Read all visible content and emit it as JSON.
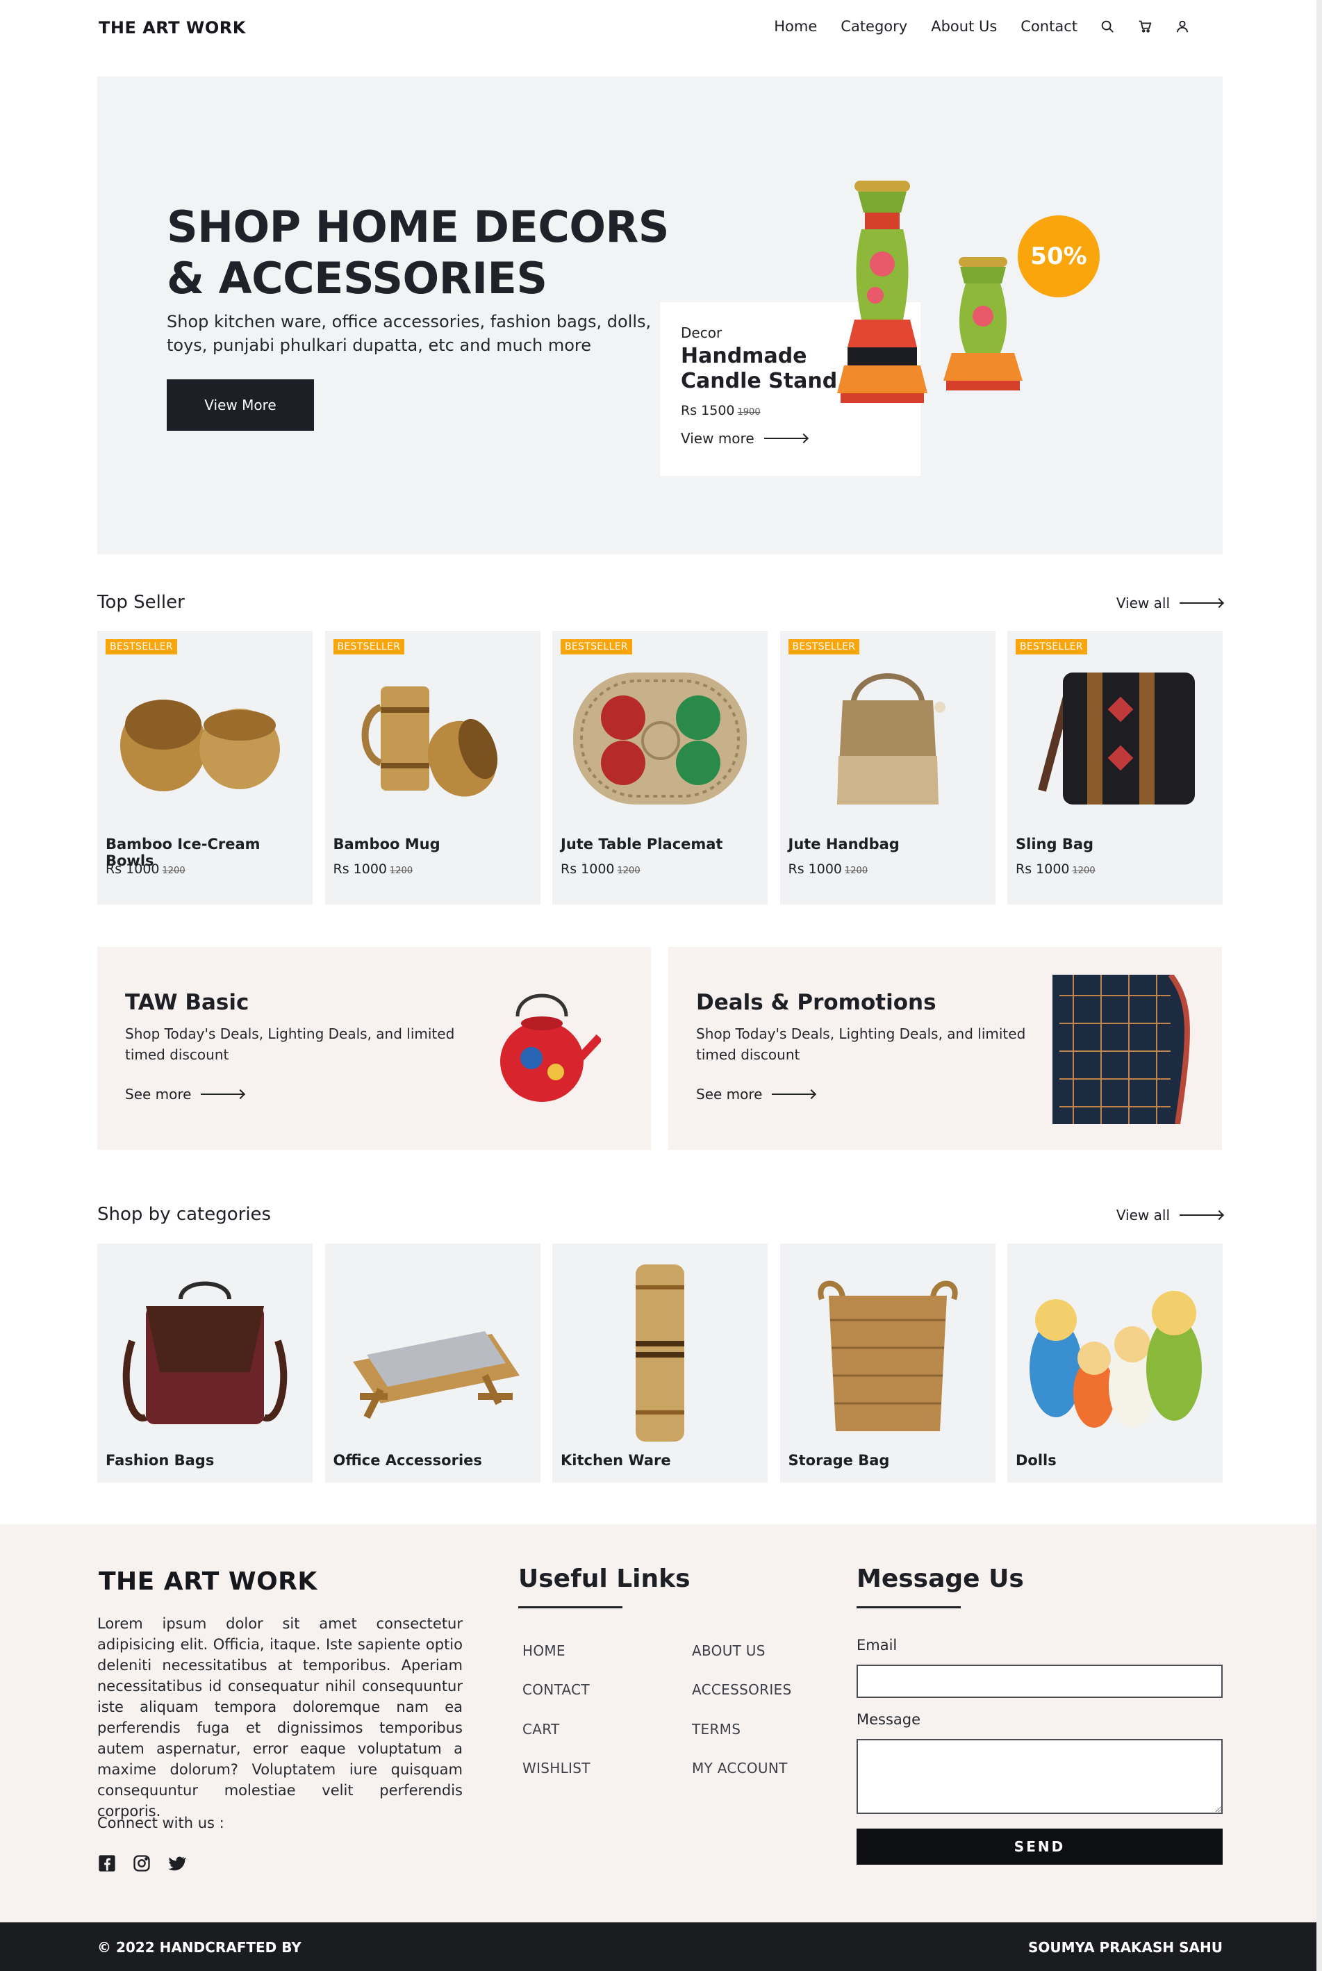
{
  "brand": {
    "name": "THE ART WORK"
  },
  "nav": {
    "links": [
      "Home",
      "Category",
      "About Us",
      "Contact"
    ],
    "icons": [
      "search-icon",
      "cart-icon",
      "user-icon"
    ]
  },
  "hero": {
    "title_line1": "SHOP HOME DECORS",
    "title_line2": "& ACCESSORIES",
    "subtitle": "Shop kitchen ware, office accessories, fashion bags, dolls, toys, punjabi phulkari dupatta, etc and much more",
    "button_label": "View More",
    "card": {
      "category": "Decor",
      "name": "Handmade Candle Stand",
      "price": "Rs 1500",
      "old_price": "1900",
      "link_label": "View more"
    },
    "discount": "50%"
  },
  "top_seller": {
    "title": "Top Seller",
    "view_all": "View all",
    "badge": "BESTSELLER",
    "items": [
      {
        "name": "Bamboo Ice-Cream Bowls",
        "price": "Rs 1000",
        "old_price": "1200"
      },
      {
        "name": "Bamboo Mug",
        "price": "Rs 1000",
        "old_price": "1200"
      },
      {
        "name": "Jute Table Placemat",
        "price": "Rs 1000",
        "old_price": "1200"
      },
      {
        "name": "Jute Handbag",
        "price": "Rs 1000",
        "old_price": "1200"
      },
      {
        "name": "Sling Bag",
        "price": "Rs 1000",
        "old_price": "1200"
      }
    ]
  },
  "promos": [
    {
      "title": "TAW Basic",
      "text": "Shop Today's Deals, Lighting Deals, and limited timed discount",
      "link": "See more"
    },
    {
      "title": "Deals & Promotions",
      "text": "Shop Today's Deals, Lighting Deals, and limited timed discount",
      "link": "See more"
    }
  ],
  "categories": {
    "title": "Shop by categories",
    "view_all": "View all",
    "items": [
      "Fashion Bags",
      "Office Accessories",
      "Kitchen Ware",
      "Storage Bag",
      "Dolls"
    ]
  },
  "footer": {
    "logo": "THE ART WORK",
    "about": "Lorem ipsum dolor sit amet consectetur adipisicing elit. Officia, itaque. Iste sapiente optio deleniti necessitatibus at temporibus. Aperiam necessitatibus id consequatur nihil consequuntur iste aliquam tempora doloremque nam ea perferendis fuga et dignissimos temporibus autem aspernatur, error eaque voluptatum a maxime dolorum? Voluptatem iure quisquam consequuntur molestiae velit perferendis corporis.",
    "connect": "Connect with us :",
    "social": [
      "facebook-icon",
      "instagram-icon",
      "twitter-icon"
    ],
    "useful_title": "Useful Links",
    "links_col1": [
      "HOME",
      "CONTACT",
      "CART",
      "WISHLIST"
    ],
    "links_col2": [
      "ABOUT US",
      "ACCESSORIES",
      "TERMS",
      "MY ACCOUNT"
    ],
    "message_title": "Message Us",
    "email_label": "Email",
    "message_label": "Message",
    "send_label": "SEND"
  },
  "copyright": {
    "left": "© 2022 HANDCRAFTED BY",
    "right": "SOUMYA PRAKASH SAHU"
  }
}
